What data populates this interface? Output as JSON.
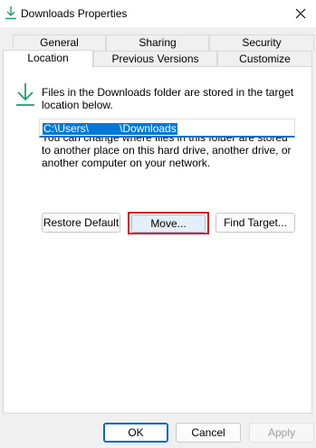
{
  "window": {
    "title": "Downloads Properties",
    "title_icon": "download-arrow-icon",
    "close_icon": "close-icon"
  },
  "tabs": {
    "row1": [
      {
        "label": "General"
      },
      {
        "label": "Sharing"
      },
      {
        "label": "Security"
      }
    ],
    "row2": [
      {
        "label": "Location",
        "active": true
      },
      {
        "label": "Previous Versions"
      },
      {
        "label": "Customize"
      }
    ]
  },
  "location": {
    "icon": "download-arrow-icon",
    "info": "Files in the Downloads folder are stored in the target location below.",
    "description": "You can change where files in this folder are stored to another place on this hard drive, another drive, or another computer on your network.",
    "path_start": "C:\\Users\\",
    "path_end": "\\Downloads",
    "restore_default": "Restore Default",
    "move": "Move...",
    "find_target": "Find Target..."
  },
  "footer": {
    "ok": "OK",
    "cancel": "Cancel",
    "apply": "Apply"
  },
  "colors": {
    "accent": "#0078d7",
    "highlight": "#d4101e",
    "icon_green": "#1f9e6e"
  }
}
